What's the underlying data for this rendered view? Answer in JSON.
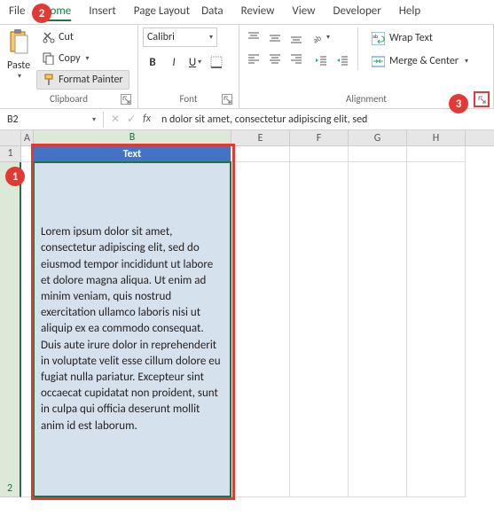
{
  "tabs": {
    "file": "File",
    "home": "Home",
    "insert": "Insert",
    "page_layout": "Page Layout",
    "data": "Data",
    "review": "Review",
    "view": "View",
    "developer": "Developer",
    "help": "Help"
  },
  "clipboard": {
    "paste": "Paste",
    "cut": "Cut",
    "copy": "Copy",
    "format_painter": "Format Painter",
    "label": "Clipboard"
  },
  "font": {
    "name": "Calibri",
    "size": "",
    "label": "Font"
  },
  "alignment": {
    "wrap": "Wrap Text",
    "merge": "Merge & Center",
    "label": "Alignment"
  },
  "formula_bar": {
    "namebox": "B2",
    "content": "n dolor sit amet, consectetur adipiscing elit, sed"
  },
  "columns": {
    "A": "A",
    "B": "B",
    "E": "E",
    "F": "F",
    "G": "G",
    "H": "H"
  },
  "rows": {
    "r1": "1",
    "r2": "2"
  },
  "cells": {
    "B1": "Text",
    "B2": "Lorem ipsum dolor sit amet, consectetur adipiscing elit, sed do eiusmod tempor incididunt ut labore et dolore magna aliqua. Ut enim ad minim veniam, quis nostrud exercitation ullamco laboris nisi ut aliquip ex ea commodo consequat. Duis aute irure dolor in reprehenderit in voluptate velit esse cillum dolore eu fugiat nulla pariatur. Excepteur sint occaecat cupidatat non proident, sunt in culpa qui officia deserunt mollit anim id est laborum."
  },
  "badges": {
    "b1": "1",
    "b2": "2",
    "b3": "3"
  }
}
